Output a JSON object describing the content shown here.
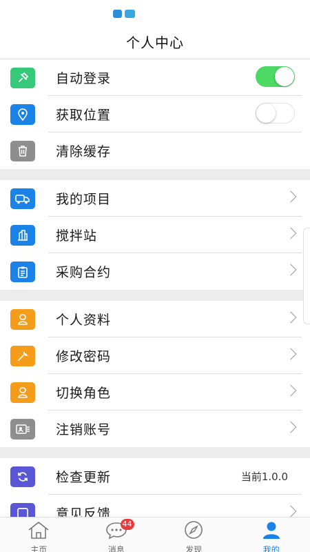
{
  "header": {
    "title": "个人中心"
  },
  "groups": [
    [
      {
        "name": "auto-login",
        "label": "自动登录",
        "icon": "pin-icon",
        "color": "green",
        "control": "toggle",
        "on": true
      },
      {
        "name": "get-location",
        "label": "获取位置",
        "icon": "location-icon",
        "color": "blue",
        "control": "toggle",
        "on": false
      },
      {
        "name": "clear-cache",
        "label": "清除缓存",
        "icon": "trash-icon",
        "color": "gray",
        "control": "none"
      }
    ],
    [
      {
        "name": "my-projects",
        "label": "我的项目",
        "icon": "truck-icon",
        "color": "blue",
        "control": "chevron"
      },
      {
        "name": "mixing-station",
        "label": "搅拌站",
        "icon": "building-icon",
        "color": "blue",
        "control": "chevron"
      },
      {
        "name": "purchase-contract",
        "label": "采购合约",
        "icon": "clipboard-icon",
        "color": "blue",
        "control": "chevron"
      }
    ],
    [
      {
        "name": "profile",
        "label": "个人资料",
        "icon": "user-icon",
        "color": "orange",
        "control": "chevron"
      },
      {
        "name": "change-password",
        "label": "修改密码",
        "icon": "wrench-icon",
        "color": "orange",
        "control": "chevron"
      },
      {
        "name": "switch-role",
        "label": "切换角色",
        "icon": "user-icon",
        "color": "orange",
        "control": "chevron"
      },
      {
        "name": "cancel-account",
        "label": "注销账号",
        "icon": "id-card-icon",
        "color": "gray",
        "control": "chevron"
      }
    ],
    [
      {
        "name": "check-update",
        "label": "检查更新",
        "icon": "refresh-icon",
        "color": "purple",
        "control": "value",
        "value": "当前1.0.0"
      },
      {
        "name": "feedback",
        "label": "意见反馈",
        "icon": "square-icon",
        "color": "purple",
        "control": "chevron"
      }
    ]
  ],
  "tabbar": {
    "items": [
      {
        "name": "home",
        "label": "主页",
        "icon": "home-icon",
        "active": false
      },
      {
        "name": "messages",
        "label": "消息",
        "icon": "chat-icon",
        "active": false,
        "badge": "44"
      },
      {
        "name": "discover",
        "label": "发现",
        "icon": "compass-icon",
        "active": false
      },
      {
        "name": "mine",
        "label": "我的",
        "icon": "person-icon",
        "active": true
      }
    ]
  },
  "colors": {
    "accent": "#1b82e8",
    "toggle_on": "#4cd964",
    "badge": "#e83b3b"
  }
}
